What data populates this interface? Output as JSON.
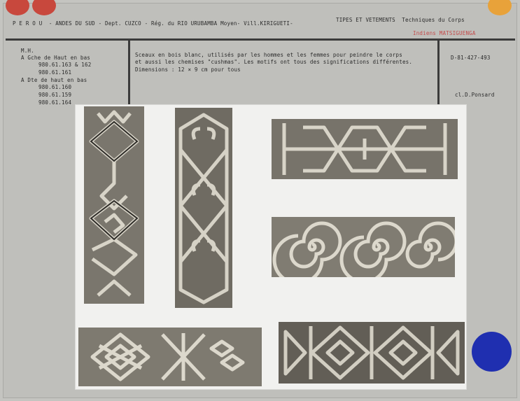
{
  "header": {
    "location": "P E R O U  - ANDES DU SUD - Dept. CUZCO - Rég. du RIO URUBAMBA Moyen- Vill.KIRIGUETI-",
    "category": "TIPES ET VETEMENTS  Techniques du Corps",
    "people": "Indiens MATSIGUENGA"
  },
  "left_column": {
    "collection": "M.H.",
    "group1_label": "A Gche de Haut en bas",
    "group1_ids": [
      "980.61.163 & 162",
      "980.61.161"
    ],
    "group2_label": "A Dte de haut en bas",
    "group2_ids": [
      "980.61.160",
      "980.61.159",
      "980.61.164"
    ]
  },
  "description": {
    "line1": "Sceaux en bois blanc, utilisés par les hommes et les femmes pour peindre le corps",
    "line2": "et aussi les chemises \"cushmas\". Les motifs ont tous des significations différentes.",
    "line3": "Dimensions : 12 × 9 cm pour tous"
  },
  "right_column": {
    "ref": "D-81-427-493",
    "credit": "cl.D.Ponsard"
  },
  "colors": {
    "dot_red": "#c8483d",
    "dot_orange": "#e8a23a",
    "dot_blue": "#1f2fb0",
    "people_red": "#c44b4b"
  }
}
